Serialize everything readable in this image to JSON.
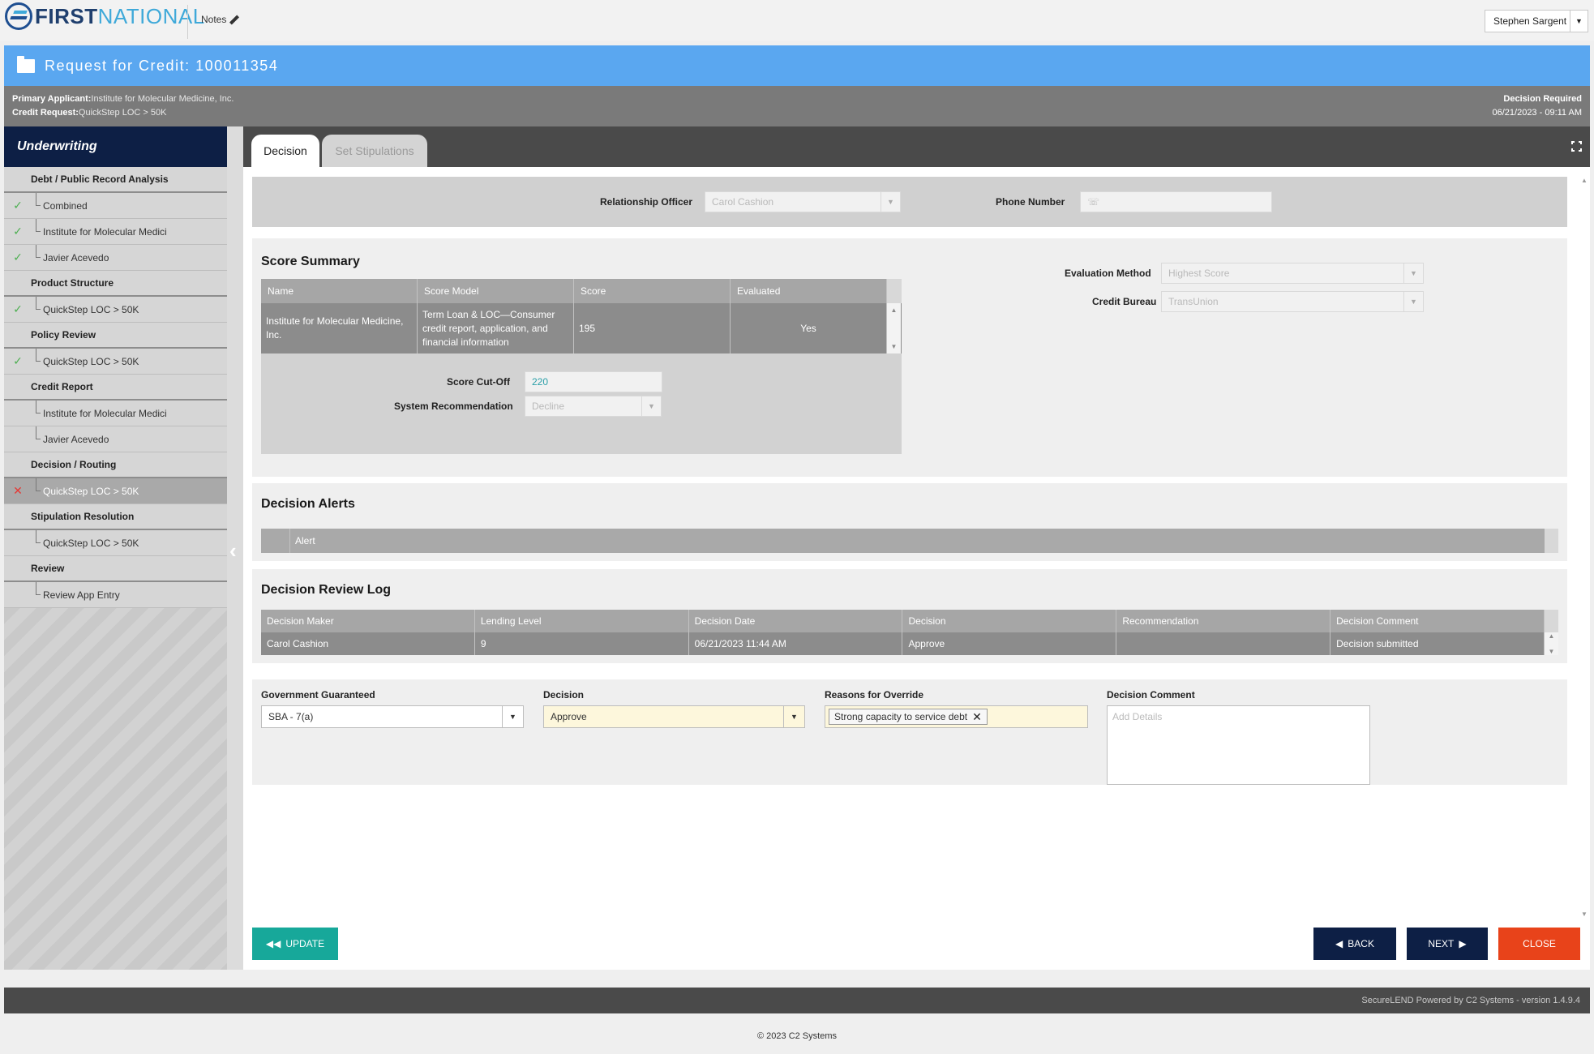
{
  "app": {
    "logo_first": "FIRST",
    "logo_national": "NATIONAL",
    "notes_label": "Notes",
    "user_name": "Stephen Sargent"
  },
  "banner": {
    "title": "Request for Credit: 100011354"
  },
  "info": {
    "primary_applicant_label": "Primary Applicant:",
    "primary_applicant_value": "Institute for Molecular Medicine, Inc.",
    "credit_request_label": "Credit Request:",
    "credit_request_value": "QuickStep LOC > 50K",
    "decision_required_label": "Decision Required",
    "decision_required_value": "06/21/2023 - 09:11 AM"
  },
  "sidebar": {
    "title": "Underwriting",
    "sections": [
      {
        "label": "Debt / Public Record Analysis",
        "items": [
          {
            "label": "Combined",
            "status": "check"
          },
          {
            "label": "Institute for Molecular Medici",
            "status": "check"
          },
          {
            "label": "Javier Acevedo",
            "status": "check"
          }
        ]
      },
      {
        "label": "Product Structure",
        "items": [
          {
            "label": "QuickStep LOC > 50K",
            "status": "check"
          }
        ]
      },
      {
        "label": "Policy Review",
        "items": [
          {
            "label": "QuickStep LOC > 50K",
            "status": "check"
          }
        ]
      },
      {
        "label": "Credit Report",
        "items": [
          {
            "label": "Institute for Molecular Medici",
            "status": "none"
          },
          {
            "label": "Javier Acevedo",
            "status": "none"
          }
        ]
      },
      {
        "label": "Decision / Routing",
        "items": [
          {
            "label": "QuickStep LOC > 50K",
            "status": "error",
            "active": true
          }
        ]
      },
      {
        "label": "Stipulation Resolution",
        "items": [
          {
            "label": "QuickStep LOC > 50K",
            "status": "none"
          }
        ]
      },
      {
        "label": "Review",
        "items": [
          {
            "label": "Review App Entry",
            "status": "none"
          }
        ]
      }
    ]
  },
  "tabs": {
    "decision": "Decision",
    "set_stipulations": "Set Stipulations"
  },
  "officer": {
    "relationship_officer_label": "Relationship Officer",
    "relationship_officer_value": "Carol Cashion",
    "phone_label": "Phone Number",
    "phone_value": ""
  },
  "score_summary": {
    "title": "Score Summary",
    "columns": [
      "Name",
      "Score Model",
      "Score",
      "Evaluated"
    ],
    "row": {
      "name": "Institute for Molecular Medicine, Inc.",
      "score_model": "Term Loan & LOC—Consumer credit report, application, and financial information",
      "score": "195",
      "evaluated": "Yes"
    },
    "cutoff_label": "Score Cut-Off",
    "cutoff_value": "220",
    "system_rec_label": "System Recommendation",
    "system_rec_value": "Decline",
    "evaluation_method_label": "Evaluation Method",
    "evaluation_method_value": "Highest Score",
    "credit_bureau_label": "Credit Bureau",
    "credit_bureau_value": "TransUnion"
  },
  "decision_alerts": {
    "title": "Decision Alerts",
    "column": "Alert"
  },
  "review_log": {
    "title": "Decision Review Log",
    "columns": [
      "Decision Maker",
      "Lending Level",
      "Decision Date",
      "Decision",
      "Recommendation",
      "Decision Comment"
    ],
    "rows": [
      [
        "Carol Cashion",
        "9",
        "06/21/2023 11:44 AM",
        "Approve",
        "",
        "Decision submitted"
      ]
    ]
  },
  "form": {
    "gov_guaranteed_label": "Government Guaranteed",
    "gov_guaranteed_value": "SBA - 7(a)",
    "decision_label": "Decision",
    "decision_value": "Approve",
    "override_label": "Reasons for Override",
    "override_tag": "Strong capacity to service debt",
    "comment_label": "Decision Comment",
    "comment_placeholder": "Add Details"
  },
  "buttons": {
    "update": "UPDATE",
    "back": "BACK",
    "next": "NEXT",
    "close": "CLOSE"
  },
  "footer": {
    "version": "SecureLEND Powered by C2 Systems - version 1.4.9.4",
    "copyright": "© 2023 C2 Systems"
  }
}
